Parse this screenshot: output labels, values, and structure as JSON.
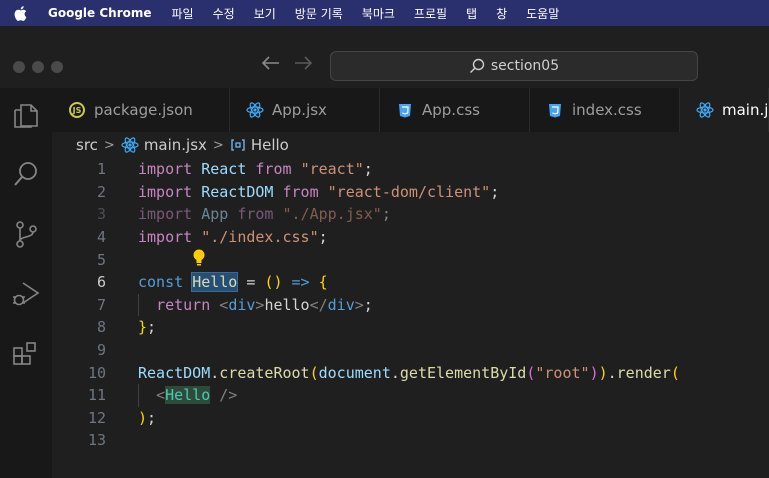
{
  "menubar": {
    "app_name": "Google Chrome",
    "items": [
      "파일",
      "수정",
      "보기",
      "방문 기록",
      "북마크",
      "프로필",
      "탭",
      "창",
      "도움말"
    ]
  },
  "titlebar": {
    "search_text": "section05"
  },
  "tabs": [
    {
      "label": "package.json",
      "icon": "js-brace-icon",
      "active": false
    },
    {
      "label": "App.jsx",
      "icon": "react-icon",
      "active": false
    },
    {
      "label": "App.css",
      "icon": "css-icon",
      "active": false
    },
    {
      "label": "index.css",
      "icon": "css-icon",
      "active": false
    },
    {
      "label": "main.jsx",
      "icon": "react-icon",
      "active": true
    }
  ],
  "breadcrumb": {
    "folder": "src",
    "file": "main.jsx",
    "symbol": "Hello"
  },
  "editor": {
    "current_line": 6,
    "lines": [
      {
        "n": "1",
        "t": "import React from \"react\";"
      },
      {
        "n": "2",
        "t": "import ReactDOM from \"react-dom/client\";"
      },
      {
        "n": "3",
        "t": "import App from \"./App.jsx\";"
      },
      {
        "n": "4",
        "t": "import \"./index.css\";"
      },
      {
        "n": "5",
        "t": ""
      },
      {
        "n": "6",
        "t": "const Hello = () => {"
      },
      {
        "n": "7",
        "t": "  return <div>hello</div>;"
      },
      {
        "n": "8",
        "t": "};"
      },
      {
        "n": "9",
        "t": ""
      },
      {
        "n": "10",
        "t": "ReactDOM.createRoot(document.getElementById(\"root\")).render("
      },
      {
        "n": "11",
        "t": "  <Hello />"
      },
      {
        "n": "12",
        "t": ");"
      },
      {
        "n": "13",
        "t": ""
      }
    ]
  },
  "colors": {
    "menubar_bg": "#2a2f6e",
    "editor_bg": "#1f1f1f",
    "react_blue": "#3fa9f5",
    "css_blue": "#42a5f5",
    "json_yellow": "#cbcb41"
  }
}
